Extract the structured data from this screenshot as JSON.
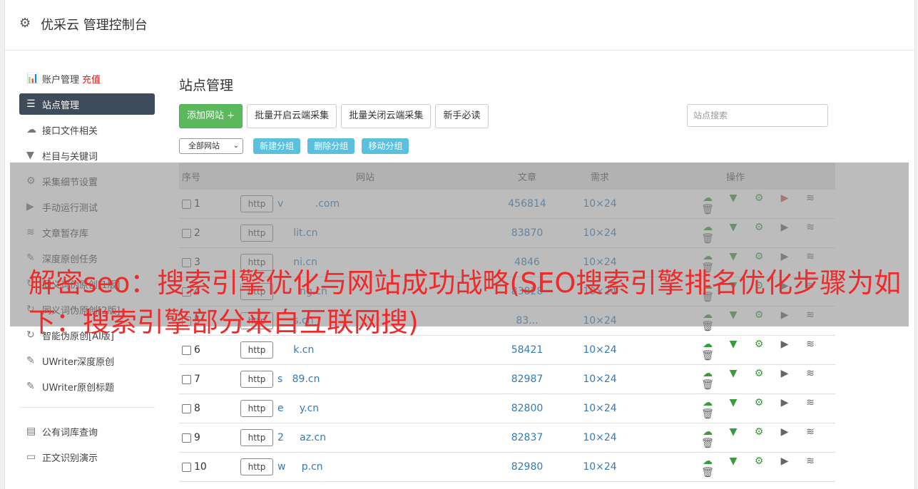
{
  "header": {
    "title": "优采云 管理控制台"
  },
  "sidebar": {
    "items": [
      {
        "label": "账户管理",
        "extra": "充值",
        "icon": "bar-chart-icon",
        "glyph": "📊"
      },
      {
        "label": "站点管理",
        "icon": "server-icon",
        "glyph": "☰"
      },
      {
        "label": "接口文件相关",
        "icon": "cloud-upload-icon",
        "glyph": "☁"
      },
      {
        "label": "栏目与关键词",
        "icon": "filter-icon",
        "glyph": "▼"
      },
      {
        "label": "采集细节设置",
        "icon": "cogs-icon",
        "glyph": "⚙"
      },
      {
        "label": "手动运行测试",
        "icon": "play-circle-icon",
        "glyph": "▶"
      },
      {
        "label": "文章暂存库",
        "icon": "database-icon",
        "glyph": "≋"
      },
      {
        "label": "深度原创任务",
        "icon": "edit-icon",
        "glyph": "✎"
      },
      {
        "label": "同义词伪原创[1版]",
        "icon": "refresh-icon",
        "glyph": "↻"
      },
      {
        "label": "同义词伪原创[2版]",
        "icon": "refresh-icon",
        "glyph": "↻"
      },
      {
        "label": "智能伪原创[AI版]",
        "icon": "refresh-icon",
        "glyph": "↻"
      },
      {
        "label": "UWriter深度原创",
        "icon": "edit-icon",
        "glyph": "✎"
      },
      {
        "label": "UWriter原创标题",
        "icon": "edit-icon",
        "glyph": "✎"
      },
      {
        "label": "公有词库查询",
        "icon": "book-icon",
        "glyph": "▤"
      },
      {
        "label": "正文识别演示",
        "icon": "monitor-icon",
        "glyph": "▭"
      }
    ]
  },
  "main": {
    "title": "站点管理",
    "toolbar": {
      "add_site": "添加网站 +",
      "batch_open": "批量开启云端采集",
      "batch_close": "批量关闭云端采集",
      "newbie": "新手必读",
      "search_placeholder": "站点搜索"
    },
    "filter": {
      "select_value": "全部网站",
      "new_group": "新建分组",
      "delete_group": "删除分组",
      "move_group": "移动分组"
    },
    "table": {
      "headers": {
        "idx": "序号",
        "site": "网站",
        "articles": "文章",
        "demand": "需求",
        "ops": "操作"
      },
      "http_label": "http",
      "rows": [
        {
          "idx": "1",
          "site": "v          .com",
          "articles": "456814",
          "demand": "10×24"
        },
        {
          "idx": "2",
          "site": "     lit.cn",
          "articles": "83870",
          "demand": "10×24"
        },
        {
          "idx": "3",
          "site": "     ni.cn",
          "articles": "4846",
          "demand": "10×24"
        },
        {
          "idx": "4",
          "site": "       ng.cn",
          "articles": "83828",
          "demand": "10×24"
        },
        {
          "idx": "5",
          "site": "     s.cn",
          "articles": "83...",
          "demand": "10×24"
        },
        {
          "idx": "6",
          "site": "     k.cn",
          "articles": "58421",
          "demand": "10×24"
        },
        {
          "idx": "7",
          "site": "s   89.cn",
          "articles": "82987",
          "demand": "10×24"
        },
        {
          "idx": "8",
          "site": "e     y.cn",
          "articles": "82800",
          "demand": "10×24"
        },
        {
          "idx": "9",
          "site": "2     az.cn",
          "articles": "82837",
          "demand": "10×24"
        },
        {
          "idx": "10",
          "site": "w     p.cn",
          "articles": "82980",
          "demand": "10×24"
        }
      ]
    }
  },
  "banner": {
    "text": "解密seo：搜索引擎优化与网站成功战略(SEO搜索引擎排名优化步骤为如下：搜索引擎部分来自互联网搜)"
  },
  "colors": {
    "accent_green": "#5cb85c",
    "accent_blue": "#5bc0de",
    "active_nav": "#3e4b5b",
    "banner_red": "#ee2a2a"
  }
}
